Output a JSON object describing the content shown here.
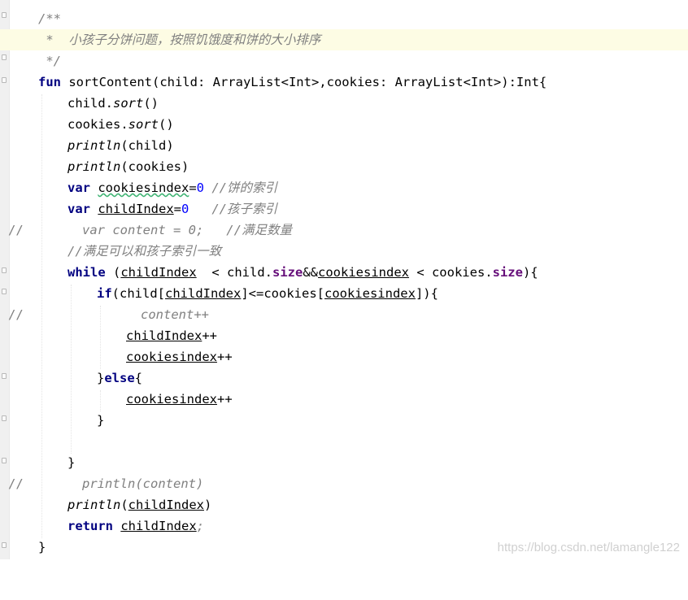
{
  "editor": {
    "language": "kotlin",
    "lines": [
      {
        "line": 1,
        "text": "/**"
      },
      {
        "line": 2,
        "text": " *  小孩子分饼问题，按照饥饿度和饼的大小排序"
      },
      {
        "line": 3,
        "text": " */"
      },
      {
        "line": 4,
        "text": "fun sortContent(child: ArrayList<Int>,cookies: ArrayList<Int>):Int{"
      },
      {
        "line": 5,
        "text": "child.sort()"
      },
      {
        "line": 6,
        "text": "cookies.sort()"
      },
      {
        "line": 7,
        "text": "println(child)"
      },
      {
        "line": 8,
        "text": "println(cookies)"
      },
      {
        "line": 9,
        "text": "var cookiesindex=0 //饼的索引"
      },
      {
        "line": 10,
        "text": "var childIndex=0   //孩子索引"
      },
      {
        "line": 11,
        "text": "//        var content = 0;   //满足数量"
      },
      {
        "line": 12,
        "text": "//满足可以和孩子索引一致"
      },
      {
        "line": 13,
        "text": "while (childIndex  < child.size&&cookiesindex < cookies.size){"
      },
      {
        "line": 14,
        "text": "if(child[childIndex]<=cookies[cookiesindex]){"
      },
      {
        "line": 15,
        "text": "//                content++"
      },
      {
        "line": 16,
        "text": "childIndex++"
      },
      {
        "line": 17,
        "text": "cookiesindex++"
      },
      {
        "line": 18,
        "text": "}else{"
      },
      {
        "line": 19,
        "text": "cookiesindex++"
      },
      {
        "line": 20,
        "text": "}"
      },
      {
        "line": 21,
        "text": ""
      },
      {
        "line": 22,
        "text": "}"
      },
      {
        "line": 23,
        "text": "//        println(content)"
      },
      {
        "line": 24,
        "text": "println(childIndex)"
      },
      {
        "line": 25,
        "text": "return childIndex;"
      },
      {
        "line": 26,
        "text": "}"
      }
    ]
  },
  "tokens": {
    "doc_open": "/**",
    "doc_body": " *  小孩子分饼问题，按照饥饿度和饼的大小排序",
    "doc_close": " */",
    "kw_fun": "fun",
    "fn_sig": " sortContent(child: ArrayList<Int>,cookies: ArrayList<Int>):Int{",
    "child": "child",
    "cookies": "cookies",
    "dot": ".",
    "sort": "sort",
    "call_empty": "()",
    "println": "println",
    "arg_child": "(child)",
    "arg_cookies": "(cookies)",
    "kw_var": "var",
    "cookiesindex": "cookiesindex",
    "childIndex": "childIndex",
    "eq": "=",
    "zero": "0",
    "cm_cookie_idx": " //饼的索引",
    "cm_child_idx": "   //孩子索引",
    "slashes": "//",
    "commented_content_decl": "var content = 0;   //满足数量",
    "cm_match": "//满足可以和孩子索引一致",
    "kw_while": "while",
    "while_open": " (",
    "while_lt1": "  < child.",
    "size": "size",
    "and": "&&",
    "while_lt2": " < cookies.",
    "brace_close_paren": "){",
    "kw_if": "if",
    "if_open": "(child[",
    "if_mid": "]<=cookies[",
    "if_close": "]){",
    "commented_content_inc": "content++",
    "inc": "++",
    "brace_close": "}",
    "kw_else": "else",
    "brace_open": "{",
    "commented_println": "println(content)",
    "paren_open": "(",
    "paren_close": ")",
    "kw_return": "return",
    "space": " ",
    "semicolon": ";"
  },
  "watermark": "https://blog.csdn.net/lamangle122",
  "colors": {
    "keyword": "#000080",
    "number": "#0000ff",
    "comment": "#808080",
    "property": "#660e7a",
    "current_line": "#fdfce4"
  }
}
